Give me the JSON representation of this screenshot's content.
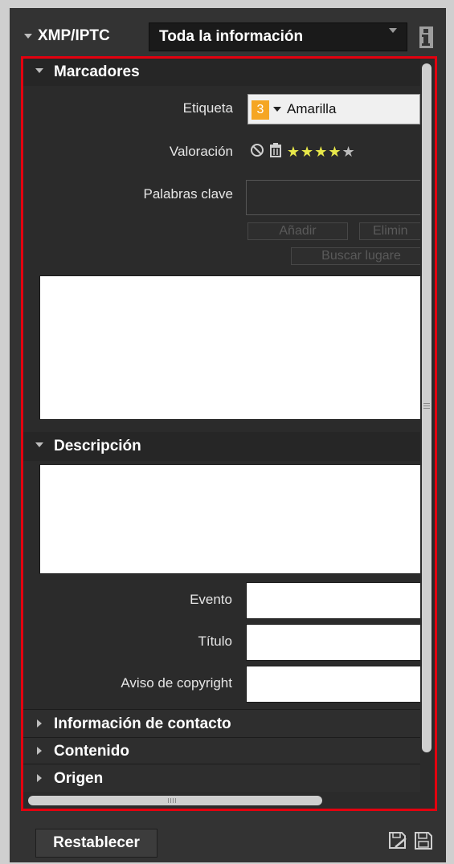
{
  "header": {
    "title": "XMP/IPTC",
    "filter_value": "Toda la información"
  },
  "markers": {
    "title": "Marcadores",
    "label_label": "Etiqueta",
    "label_number": "3",
    "label_value": "Amarilla",
    "label_color": "#f5a623",
    "rating_label": "Valoración",
    "rating": 4,
    "rating_max": 5,
    "keywords_label": "Palabras clave",
    "add_button": "Añadir",
    "delete_button": "Elimin",
    "find_places_button": "Buscar lugare"
  },
  "description": {
    "title": "Descripción",
    "event_label": "Evento",
    "title_label": "Título",
    "copyright_label": "Aviso de copyright"
  },
  "collapsed_sections": [
    "Información de contacto",
    "Contenido",
    "Origen"
  ],
  "footer": {
    "reset_button": "Restablecer"
  },
  "colors": {
    "highlight_border": "#e3000f",
    "star_active": "#e8e84a",
    "star_inactive": "#bdbdbd"
  },
  "icons": [
    "info-icon",
    "no-rating-icon",
    "reject-icon",
    "star-icon",
    "save-metadata-icon",
    "save-icon"
  ]
}
